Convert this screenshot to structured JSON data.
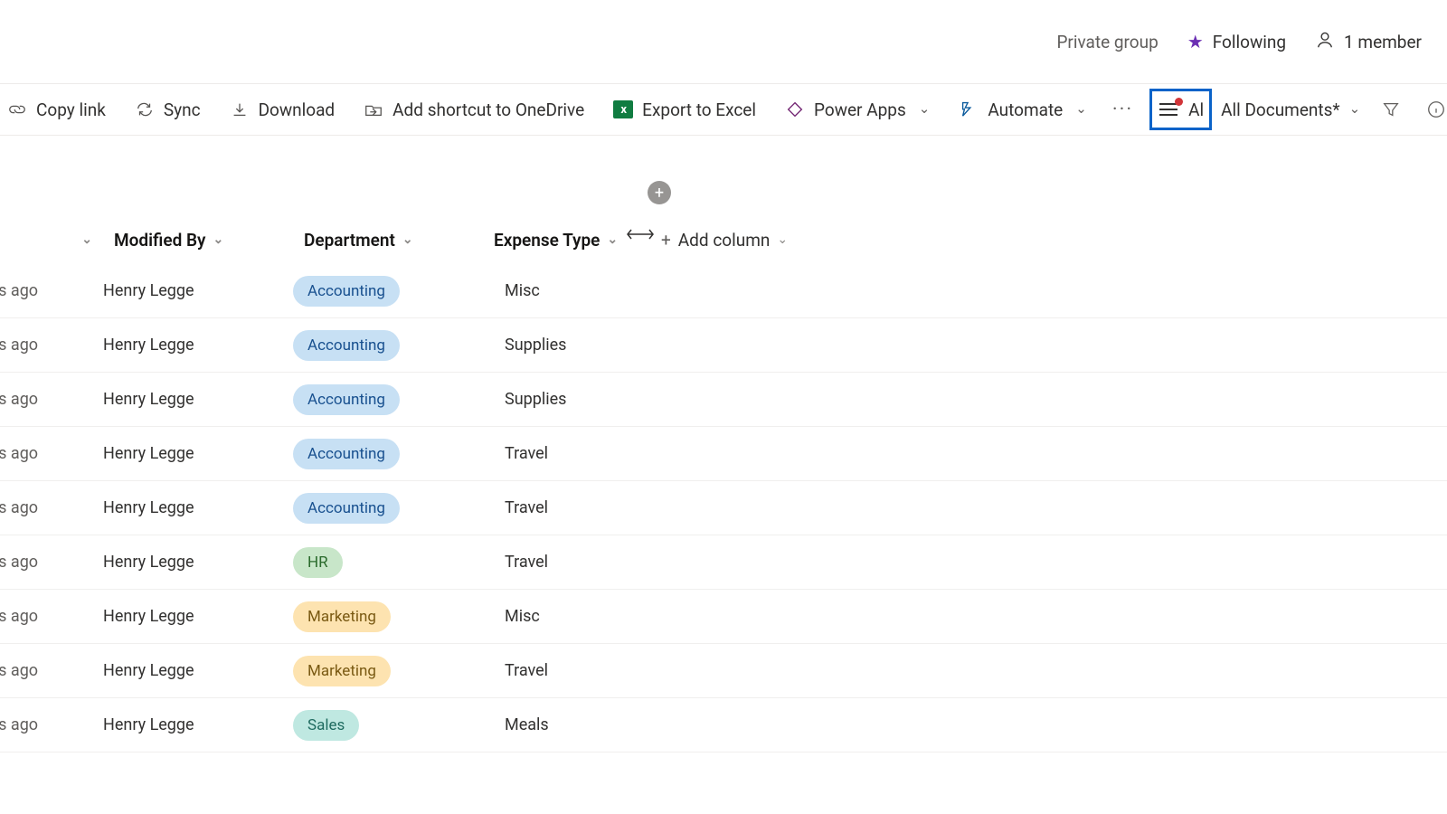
{
  "header": {
    "privacy": "Private group",
    "following": "Following",
    "members": "1 member"
  },
  "commands": {
    "copy_link": "Copy link",
    "sync": "Sync",
    "download": "Download",
    "add_to_onedrive": "Add shortcut to OneDrive",
    "export_excel": "Export to Excel",
    "power_apps": "Power Apps",
    "automate": "Automate",
    "view_name": "All Documents*",
    "view_left_fragment": "Al"
  },
  "columns": {
    "modified_by": "Modified By",
    "department": "Department",
    "expense_type": "Expense Type",
    "add_column": "Add column"
  },
  "modified_fragment": "ds ago",
  "departments": {
    "accounting": "Accounting",
    "hr": "HR",
    "marketing": "Marketing",
    "sales": "Sales"
  },
  "rows": [
    {
      "modified_by": "Henry Legge",
      "dept": "accounting",
      "etype": "Misc"
    },
    {
      "modified_by": "Henry Legge",
      "dept": "accounting",
      "etype": "Supplies"
    },
    {
      "modified_by": "Henry Legge",
      "dept": "accounting",
      "etype": "Supplies"
    },
    {
      "modified_by": "Henry Legge",
      "dept": "accounting",
      "etype": "Travel"
    },
    {
      "modified_by": "Henry Legge",
      "dept": "accounting",
      "etype": "Travel"
    },
    {
      "modified_by": "Henry Legge",
      "dept": "hr",
      "etype": "Travel"
    },
    {
      "modified_by": "Henry Legge",
      "dept": "marketing",
      "etype": "Misc"
    },
    {
      "modified_by": "Henry Legge",
      "dept": "marketing",
      "etype": "Travel"
    },
    {
      "modified_by": "Henry Legge",
      "dept": "sales",
      "etype": "Meals"
    }
  ]
}
